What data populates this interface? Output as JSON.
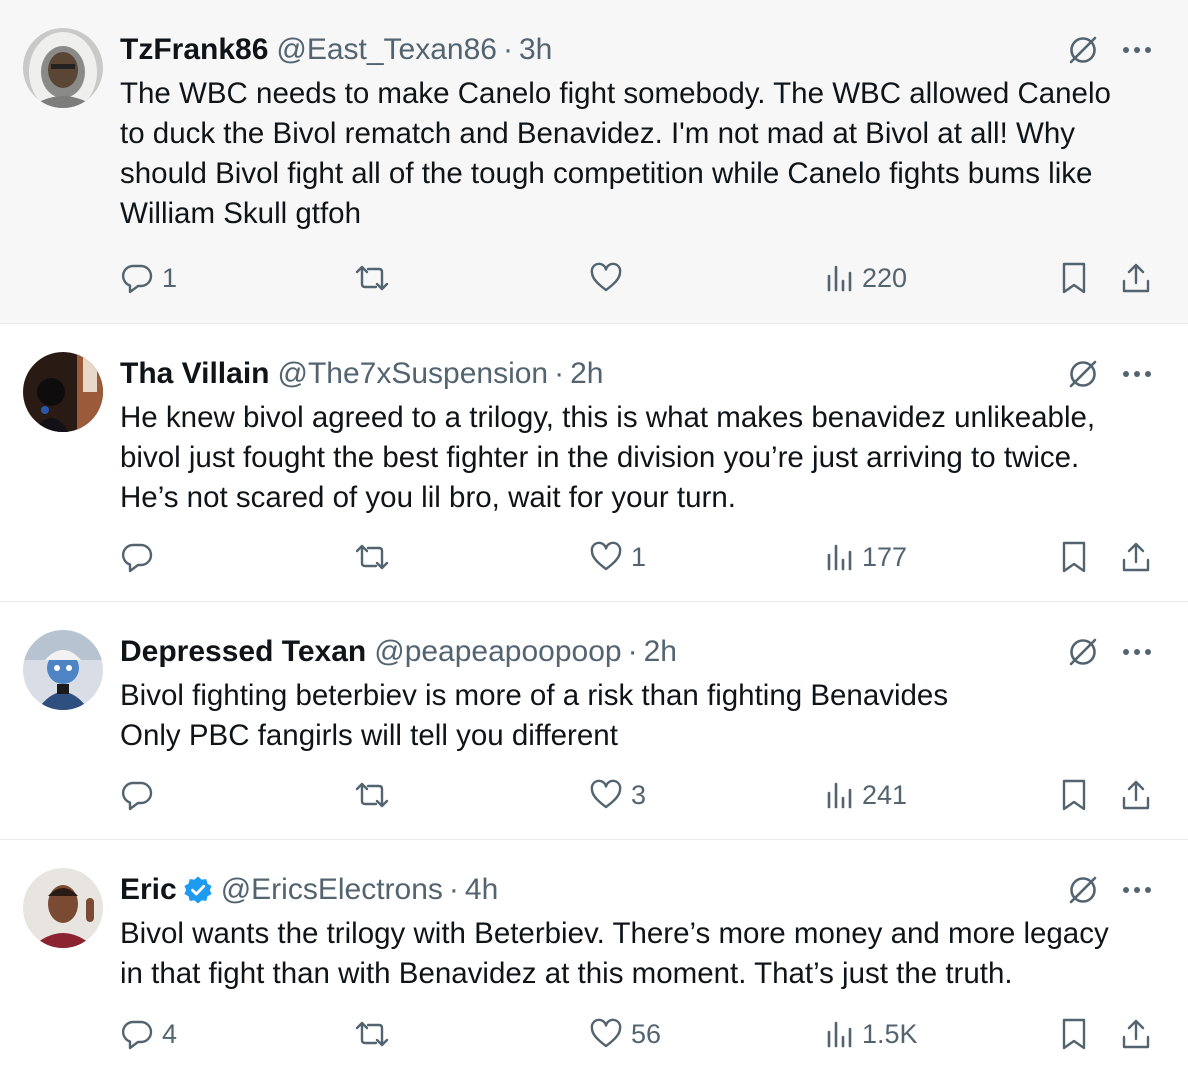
{
  "tweets": [
    {
      "name": "TzFrank86",
      "handle": "@East_Texan86",
      "time": "3h",
      "verified": false,
      "text": "The WBC needs to make Canelo fight somebody. The WBC allowed Canelo\nto duck the Bivol rematch and Benavidez. I'm not mad at Bivol at all! Why\nshould Bivol fight all of the tough competition while Canelo fights bums like\nWilliam Skull gtfoh",
      "replies": "1",
      "reposts": "",
      "likes": "",
      "views": "220",
      "highlighted": true
    },
    {
      "name": "Tha Villain",
      "handle": "@The7xSuspension",
      "time": "2h",
      "verified": false,
      "text": "He knew bivol agreed to a trilogy, this is what makes benavidez unlikeable,\nbivol just fought the best fighter in the division you’re just arriving to twice.\nHe’s not scared of you lil bro, wait for your turn.",
      "replies": "",
      "reposts": "",
      "likes": "1",
      "views": "177",
      "highlighted": false
    },
    {
      "name": "Depressed Texan",
      "handle": "@peapeapoopoop",
      "time": "2h",
      "verified": false,
      "text": "Bivol fighting beterbiev is more of a risk than fighting Benavides\nOnly PBC fangirls will tell you different",
      "replies": "",
      "reposts": "",
      "likes": "3",
      "views": "241",
      "highlighted": false
    },
    {
      "name": "Eric",
      "handle": "@EricsElectrons",
      "time": "4h",
      "verified": true,
      "text": "Bivol wants the trilogy with Beterbiev. There’s more money and more legacy\nin that fight than with Benavidez at this moment. That’s just the truth.",
      "replies": "4",
      "reposts": "",
      "likes": "56",
      "views": "1.5K",
      "highlighted": false
    }
  ],
  "separator": "·",
  "colors": {
    "text": "#0f1419",
    "muted": "#536471",
    "verified": "#1d9bf0",
    "highlight_bg": "#f7f7f7",
    "border": "#e7e9ea"
  },
  "icons": {
    "reply": "reply-icon",
    "repost": "repost-icon",
    "like": "heart-icon",
    "views": "views-icon",
    "bookmark": "bookmark-icon",
    "share": "share-icon",
    "grok": "grok-icon",
    "more": "more-icon",
    "verified": "verified-badge-icon"
  }
}
